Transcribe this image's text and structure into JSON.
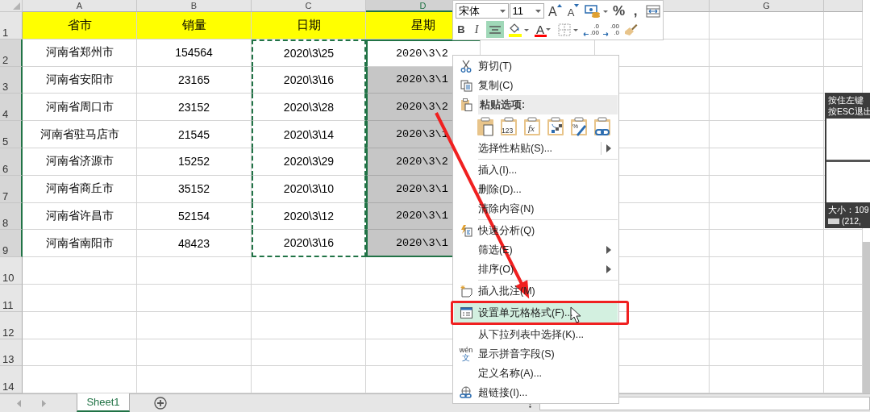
{
  "toolbar": {
    "font": "宋体",
    "size": "11",
    "row1": [
      {
        "kind": "grow",
        "label": "A"
      },
      {
        "kind": "shrink",
        "label": "A"
      },
      {
        "kind": "format"
      },
      {
        "kind": "percent",
        "label": "%"
      },
      {
        "kind": "comma",
        "label": ","
      },
      {
        "kind": "wrap"
      }
    ],
    "row2": [
      {
        "kind": "bold",
        "label": "B"
      },
      {
        "kind": "italic",
        "label": "I"
      },
      {
        "kind": "align",
        "selected": true
      },
      {
        "kind": "fill",
        "color": "#ffff00"
      },
      {
        "kind": "fontcolor",
        "label": "A",
        "color": "#ff0000"
      },
      {
        "kind": "border"
      },
      {
        "kind": "inc-decimal",
        "top": ".0",
        "bottom": ".00"
      },
      {
        "kind": "dec-decimal",
        "top": ".00",
        "bottom": ".0"
      },
      {
        "kind": "painter"
      }
    ]
  },
  "columns": [
    {
      "label": "A",
      "selected": false,
      "copied": false
    },
    {
      "label": "B",
      "selected": false,
      "copied": false
    },
    {
      "label": "C",
      "selected": false,
      "copied": true
    },
    {
      "label": "D",
      "selected": true,
      "copied": false
    },
    {
      "selected": false,
      "copied": false
    },
    {
      "selected": false,
      "copied": false
    },
    {
      "label": "G",
      "selected": false,
      "copied": false
    }
  ],
  "rows": [
    {
      "label": "1",
      "kind": "header",
      "selected": false,
      "cells": [
        "省市",
        "销量",
        "日期",
        "星期"
      ]
    },
    {
      "label": "2",
      "kind": "data",
      "selected": true,
      "active": true,
      "cells": [
        "河南省郑州市",
        "154564",
        "2020\\3\\25",
        "2020\\3\\2"
      ]
    },
    {
      "label": "3",
      "kind": "data",
      "selected": true,
      "active": false,
      "cells": [
        "河南省安阳市",
        "23165",
        "2020\\3\\16",
        "2020\\3\\1"
      ]
    },
    {
      "label": "4",
      "kind": "data",
      "selected": true,
      "active": false,
      "cells": [
        "河南省周口市",
        "23152",
        "2020\\3\\28",
        "2020\\3\\2"
      ]
    },
    {
      "label": "5",
      "kind": "data",
      "selected": true,
      "active": false,
      "cells": [
        "河南省驻马店市",
        "21545",
        "2020\\3\\14",
        "2020\\3\\1"
      ]
    },
    {
      "label": "6",
      "kind": "data",
      "selected": true,
      "active": false,
      "cells": [
        "河南省济源市",
        "15252",
        "2020\\3\\29",
        "2020\\3\\2"
      ]
    },
    {
      "label": "7",
      "kind": "data",
      "selected": true,
      "active": false,
      "cells": [
        "河南省商丘市",
        "35152",
        "2020\\3\\10",
        "2020\\3\\1"
      ]
    },
    {
      "label": "8",
      "kind": "data",
      "selected": true,
      "active": false,
      "cells": [
        "河南省许昌市",
        "52154",
        "2020\\3\\12",
        "2020\\3\\1"
      ]
    },
    {
      "label": "9",
      "kind": "data",
      "selected": true,
      "active": false,
      "cells": [
        "河南省南阳市",
        "48423",
        "2020\\3\\16",
        "2020\\3\\1"
      ]
    },
    {
      "label": "10",
      "kind": "empty",
      "selected": false,
      "cells": []
    },
    {
      "label": "11",
      "kind": "empty",
      "selected": false,
      "cells": []
    },
    {
      "label": "12",
      "kind": "empty",
      "selected": false,
      "cells": []
    },
    {
      "label": "13",
      "kind": "empty",
      "selected": false,
      "cells": []
    },
    {
      "label": "14",
      "kind": "empty",
      "selected": false,
      "cells": []
    }
  ],
  "context_menu": [
    {
      "kind": "item",
      "label": "剪切(T)",
      "submenu": false,
      "highlighted": false,
      "separator_before": false
    },
    {
      "kind": "item",
      "label": "复制(C)",
      "submenu": false,
      "highlighted": false,
      "separator_before": false
    },
    {
      "kind": "header",
      "label": "粘贴选项:"
    },
    {
      "kind": "paste-icons",
      "options": [
        {
          "kind": "plain"
        },
        {
          "kind": "values",
          "label": "123"
        },
        {
          "kind": "formulas",
          "label": "fx"
        },
        {
          "kind": "transpose"
        },
        {
          "kind": "formatting",
          "label": "%"
        },
        {
          "kind": "link"
        }
      ]
    },
    {
      "kind": "item",
      "label": "选择性粘贴(S)...",
      "submenu": true,
      "highlighted": false,
      "separator_before": false
    },
    {
      "kind": "item",
      "label": "插入(I)...",
      "submenu": false,
      "highlighted": false,
      "separator_before": true
    },
    {
      "kind": "item",
      "label": "删除(D)...",
      "submenu": false,
      "highlighted": false,
      "separator_before": false
    },
    {
      "kind": "item",
      "label": "清除内容(N)",
      "submenu": false,
      "highlighted": false,
      "separator_before": false
    },
    {
      "kind": "item",
      "label": "快速分析(Q)",
      "submenu": false,
      "highlighted": false,
      "separator_before": true
    },
    {
      "kind": "item",
      "label": "筛选(E)",
      "submenu": true,
      "highlighted": false,
      "separator_before": false
    },
    {
      "kind": "item",
      "label": "排序(O)",
      "submenu": true,
      "highlighted": false,
      "separator_before": false
    },
    {
      "kind": "item",
      "label": "插入批注(M)",
      "submenu": false,
      "highlighted": false,
      "separator_before": true
    },
    {
      "kind": "item",
      "label": "设置单元格格式(F)...",
      "submenu": false,
      "highlighted": true,
      "separator_before": false
    },
    {
      "kind": "item",
      "label": "从下拉列表中选择(K)...",
      "submenu": false,
      "highlighted": false,
      "separator_before": false
    },
    {
      "kind": "item",
      "label": "显示拼音字段(S)",
      "submenu": false,
      "highlighted": false,
      "separator_before": false,
      "icon_text": [
        "wén",
        "文"
      ]
    },
    {
      "kind": "item",
      "label": "定义名称(A)...",
      "submenu": false,
      "highlighted": false,
      "separator_before": false
    },
    {
      "kind": "item",
      "label": "超链接(I)...",
      "submenu": false,
      "highlighted": false,
      "separator_before": false
    }
  ],
  "capture_info": {
    "hint_lines": [
      "按住左键",
      "按ESC退出"
    ],
    "size": "大小：109",
    "rgb": "(212,"
  },
  "sheet_tabs": [
    {
      "label": "Sheet1",
      "selected": true
    }
  ]
}
